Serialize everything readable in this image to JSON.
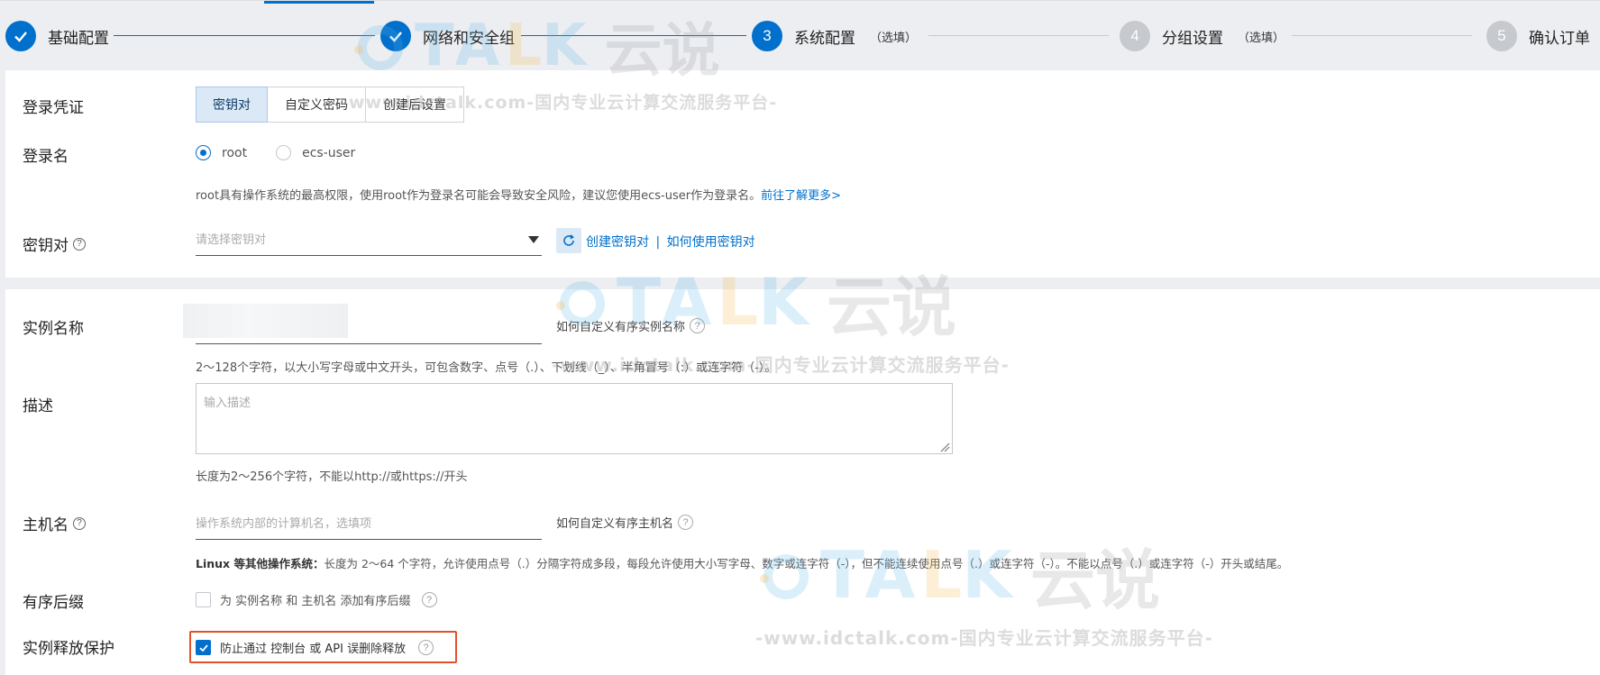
{
  "stepper": {
    "steps": [
      {
        "num": "1",
        "title": "基础配置",
        "sub": "",
        "state": "done"
      },
      {
        "num": "2",
        "title": "网络和安全组",
        "sub": "",
        "state": "done"
      },
      {
        "num": "3",
        "title": "系统配置",
        "sub": "（选填）",
        "state": "current"
      },
      {
        "num": "4",
        "title": "分组设置",
        "sub": "（选填）",
        "state": "todo"
      },
      {
        "num": "5",
        "title": "确认订单",
        "sub": "",
        "state": "todo"
      }
    ]
  },
  "login": {
    "credential_label": "登录凭证",
    "credential_options": [
      "密钥对",
      "自定义密码",
      "创建后设置"
    ],
    "credential_selected": "密钥对",
    "name_label": "登录名",
    "name_options": [
      "root",
      "ecs-user"
    ],
    "name_selected": "root",
    "root_note": "root具有操作系统的最高权限，使用root作为登录名可能会导致安全风险，建议您使用ecs-user作为登录名。",
    "root_note_link": "前往了解更多>",
    "keypair_label": "密钥对",
    "keypair_placeholder": "请选择密钥对",
    "create_keypair_link": "创建密钥对",
    "link_separator": "|",
    "how_to_use_link": "如何使用密钥对"
  },
  "instance": {
    "name_label": "实例名称",
    "name_help_text": "如何自定义有序实例名称",
    "name_rule": "2～128个字符，以大小写字母或中文开头，可包含数字、点号（.）、下划线（_）、半角冒号（:）或连字符（-）。",
    "desc_label": "描述",
    "desc_placeholder": "输入描述",
    "desc_rule": "长度为2～256个字符，不能以http://或https://开头",
    "host_label": "主机名",
    "host_placeholder": "操作系统内部的计算机名，选填项",
    "host_help_text": "如何自定义有序主机名",
    "host_rule_bold": "Linux 等其他操作系统：",
    "host_rule": "长度为 2～64 个字符，允许使用点号（.）分隔字符成多段，每段允许使用大小写字母、数字或连字符（-），但不能连续使用点号（.）或连字符（-）。不能以点号（.）或连字符（-）开头或结尾。",
    "suffix_label": "有序后缀",
    "suffix_text": "为 实例名称 和 主机名 添加有序后缀",
    "suffix_checked": false,
    "protect_label": "实例释放保护",
    "protect_text": "防止通过 控制台 或 API 误删除释放",
    "protect_checked": true
  },
  "watermark": {
    "brand_a": "TA",
    "brand_b": "L",
    "brand_c": "K",
    "brand_cn": "云说",
    "url": "-www.idctalk.com-国内专业云计算交流服务平台-"
  },
  "colors": {
    "accent": "#0070cc",
    "highlight": "#e0532a",
    "page_bg": "#eceef1"
  }
}
